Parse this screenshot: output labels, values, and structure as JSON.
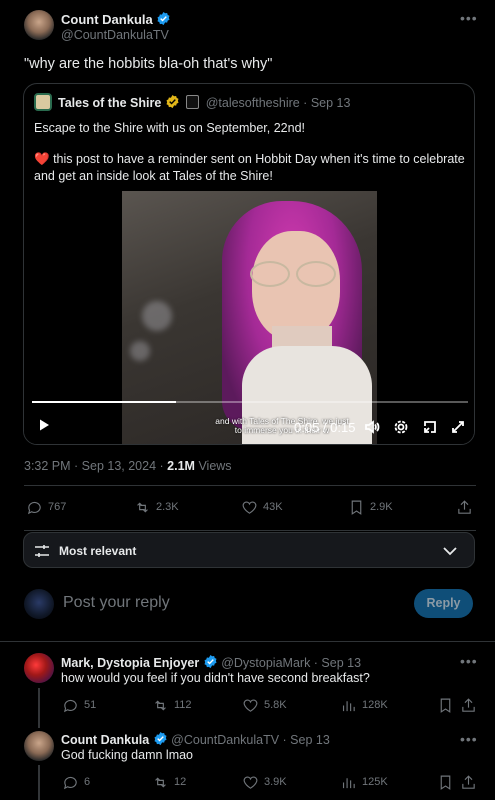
{
  "main_post": {
    "author_name": "Count Dankula",
    "handle": "@CountDankulaTV",
    "text": "\"why are the hobbits bla-oh that's why\"",
    "timestamp": "3:32 PM · Sep 13, 2024 ·",
    "views_count": "2.1M",
    "views_label": "Views",
    "stats": {
      "replies": "767",
      "reposts": "2.3K",
      "likes": "43K",
      "bookmarks": "2.9K"
    }
  },
  "quoted_post": {
    "author_name": "Tales of the Shire",
    "handle": "@talesoftheshire · Sep 13",
    "line1": "Escape to the Shire with us on September, 22nd!",
    "line2a": "this post to have a reminder sent on Hobbit Day when it's time to celebrate",
    "line2b": "and get an inside look at Tales of the Shire!",
    "video": {
      "caption_line1": "and with Tales of The Shire, we just",
      "caption_line2": "to immerse you in their w",
      "time": "0:05 / 0:15",
      "progress": 0.33
    }
  },
  "sort": {
    "label": "Most relevant"
  },
  "composer": {
    "placeholder": "Post your reply",
    "reply_button": "Reply"
  },
  "replies": [
    {
      "author_name": "Mark, Dystopia Enjoyer",
      "handle": "@DystopiaMark · Sep 13",
      "text": "how would you feel if you didn't have second breakfast?",
      "stats": {
        "replies": "51",
        "reposts": "112",
        "likes": "5.8K",
        "views": "128K"
      }
    },
    {
      "author_name": "Count Dankula",
      "handle": "@CountDankulaTV · Sep 13",
      "text": "God fucking damn lmao",
      "stats": {
        "replies": "6",
        "reposts": "12",
        "likes": "3.9K",
        "views": "125K"
      }
    }
  ],
  "colors": {
    "accent": "#1d9bf0",
    "gold": "#e2b719",
    "like_red": "#f91880"
  }
}
